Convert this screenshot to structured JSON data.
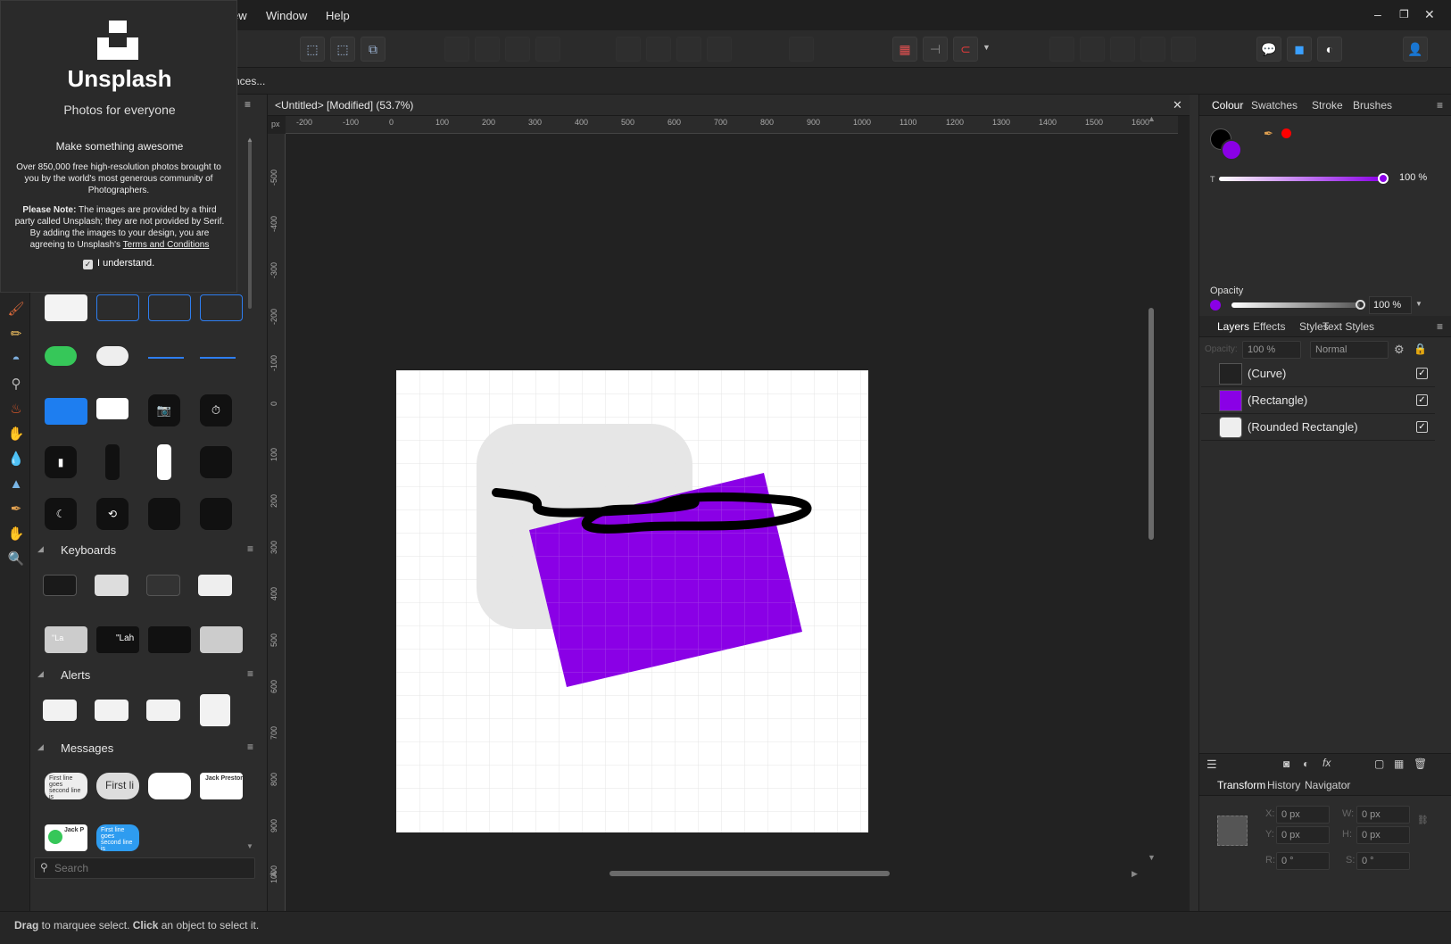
{
  "menu": {
    "items": [
      "ew",
      "Window",
      "Help"
    ]
  },
  "window_controls": {
    "minimize": "–",
    "restore": "❐",
    "close": "✕"
  },
  "context": {
    "truncated_label": "nces..."
  },
  "unsplash": {
    "title": "Unsplash",
    "tagline": "Photos for everyone",
    "heading": "Make something awesome",
    "body": "Over 850,000 free high-resolution photos brought to you by the world's most generous community of Photographers.",
    "note_bold": "Please Note:",
    "note_text": " The images are provided by a third party called Unsplash; they are not provided by Serif. By adding the images to your design, you are agreeing to Unsplash's ",
    "terms_link": "Terms and Conditions",
    "checkbox_label": "I understand.",
    "checkbox_checked": true
  },
  "assets": {
    "sections": [
      {
        "label": "Keyboards"
      },
      {
        "label": "Alerts"
      },
      {
        "label": "Messages"
      }
    ],
    "search_placeholder": "Search",
    "message_snippets": [
      "First line goes second line is",
      "First li",
      "Jack Preston",
      "Jack P",
      "First line goes second line is"
    ],
    "keyboard_snippets": [
      "\"La",
      "\"Lah"
    ]
  },
  "document": {
    "tab_title": "<Untitled> [Modified] (53.7%)",
    "ruler_unit": "px",
    "h_ticks": [
      "-200",
      "-100",
      "0",
      "100",
      "200",
      "300",
      "400",
      "500",
      "600",
      "700",
      "800",
      "900",
      "1000",
      "1100",
      "1200",
      "1300",
      "1400",
      "1500",
      "1600"
    ],
    "v_ticks": [
      "-500",
      "-400",
      "-300",
      "-200",
      "-100",
      "0",
      "100",
      "200",
      "300",
      "400",
      "500",
      "600",
      "700",
      "800",
      "900",
      "1000"
    ]
  },
  "colour_panel": {
    "tabs": [
      "Colour",
      "Swatches",
      "Stroke",
      "Brushes"
    ],
    "active_tab": "Colour",
    "fill_color": "#8a00e6",
    "stroke_color": "#000000",
    "extra_color": "#ff0000",
    "tint_label": "T",
    "tint_value": "100 %",
    "opacity_label": "Opacity",
    "opacity_value": "100 %"
  },
  "layers_panel": {
    "tabs": [
      "Layers",
      "Effects",
      "Styles",
      "Text Styles"
    ],
    "active_tab": "Layers",
    "opacity_label": "Opacity:",
    "opacity_value": "100 %",
    "blend_mode": "Normal",
    "layers": [
      {
        "name": "(Curve)",
        "visible": true
      },
      {
        "name": "(Rectangle)",
        "visible": true
      },
      {
        "name": "(Rounded Rectangle)",
        "visible": true
      }
    ]
  },
  "transform_panel": {
    "tabs": [
      "Transform",
      "History",
      "Navigator"
    ],
    "active_tab": "Transform",
    "x_label": "X:",
    "x_value": "0 px",
    "y_label": "Y:",
    "y_value": "0 px",
    "w_label": "W:",
    "w_value": "0 px",
    "h_label": "H:",
    "h_value": "0 px",
    "r_label": "R:",
    "r_value": "0 °",
    "s_label": "S:",
    "s_value": "0 °"
  },
  "status": {
    "drag_bold": "Drag",
    "drag_text": " to marquee select. ",
    "click_bold": "Click",
    "click_text": " an object to select it."
  }
}
